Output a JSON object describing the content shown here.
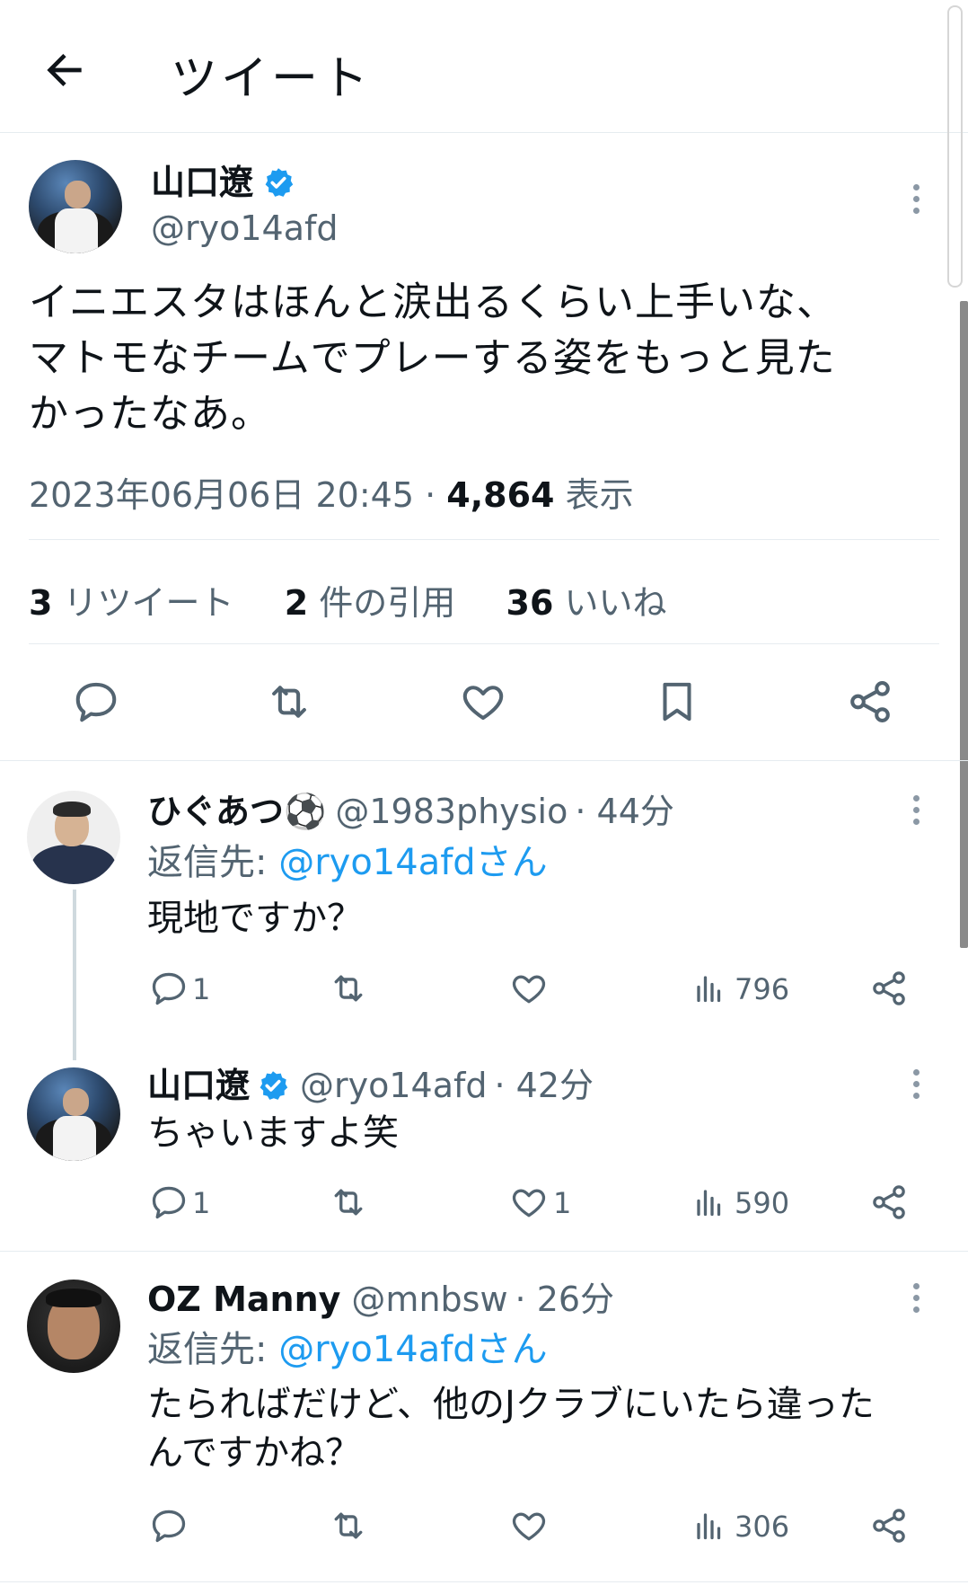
{
  "header": {
    "title": "ツイート"
  },
  "tweet": {
    "name": "山口遼",
    "handle": "@ryo14afd",
    "text_lines": [
      "イニエスタはほんと涙出るくらい上手いな、",
      "マトモなチームでプレーする姿をもっと見た",
      "かったなあ。"
    ],
    "date": "2023年06月06日 20:45",
    "sep": "·",
    "views": "4,864",
    "views_label": "表示",
    "retweets": "3",
    "retweets_label": "リツイート",
    "quotes": "2",
    "quotes_label": "件の引用",
    "likes": "36",
    "likes_label": "いいね"
  },
  "replies": [
    {
      "name": "ひぐあつ",
      "emoji": "⚽",
      "handle": "@1983physio",
      "time": "· 44分",
      "reply_to_prefix": "返信先:",
      "reply_to": "@ryo14afdさん",
      "text": "現地ですか？",
      "reply_count": "1",
      "retweet_count": "",
      "like_count": "",
      "views": "796"
    },
    {
      "name": "山口遼",
      "handle": "@ryo14afd",
      "time": "· 42分",
      "text": "ちゃいますよ笑",
      "reply_count": "1",
      "retweet_count": "",
      "like_count": "1",
      "views": "590"
    },
    {
      "name": "OZ Manny",
      "handle": "@mnbsw",
      "time": "· 26分",
      "reply_to_prefix": "返信先:",
      "reply_to": "@ryo14afdさん",
      "text_lines": [
        "たらればだけど、他のJクラブにいたら違った",
        "んですかね？"
      ],
      "reply_count": "",
      "retweet_count": "",
      "like_count": "",
      "views": "306"
    }
  ],
  "colors": {
    "accent": "#1d9bf0",
    "muted": "#536471",
    "text": "#0f1419"
  },
  "icons": [
    "back-arrow-icon",
    "verified-badge-icon",
    "more-icon",
    "reply-icon",
    "retweet-icon",
    "like-icon",
    "bookmark-icon",
    "share-icon",
    "views-icon"
  ]
}
